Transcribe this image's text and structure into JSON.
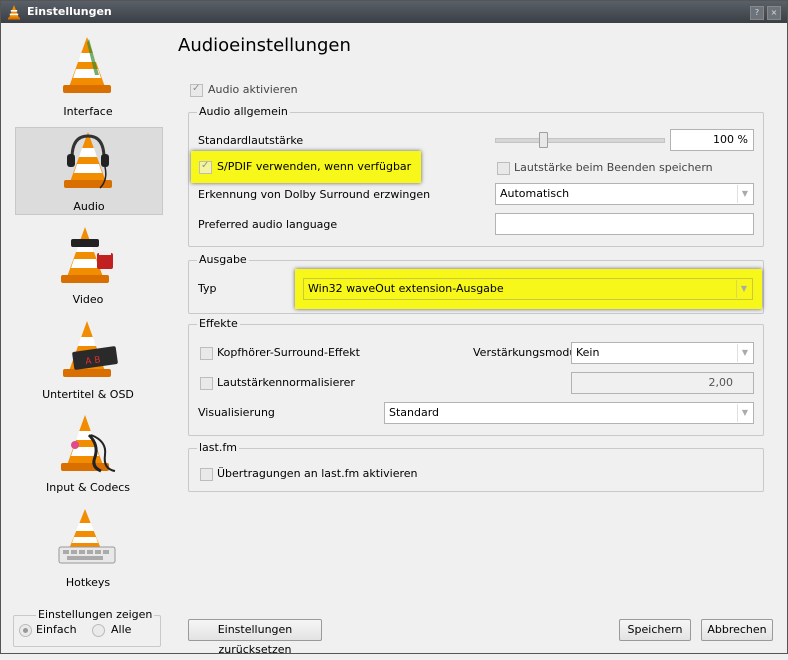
{
  "window": {
    "title": "Einstellungen",
    "buttons": [
      "?",
      "×"
    ]
  },
  "sidebar": {
    "items": [
      {
        "label": "Interface",
        "icon": "vlc-cone-icon"
      },
      {
        "label": "Audio",
        "icon": "vlc-cone-headphones-icon",
        "selected": true
      },
      {
        "label": "Video",
        "icon": "vlc-cone-film-icon"
      },
      {
        "label": "Untertitel & OSD",
        "icon": "vlc-cone-subtitle-icon"
      },
      {
        "label": "Input & Codecs",
        "icon": "vlc-cone-cable-icon"
      },
      {
        "label": "Hotkeys",
        "icon": "vlc-cone-keyboard-icon"
      }
    ],
    "show_settings": {
      "title": "Einstellungen zeigen",
      "simple": "Einfach",
      "all": "Alle",
      "selected": "Einfach"
    }
  },
  "main": {
    "title": "Audioeinstellungen",
    "enable_audio": "Audio aktivieren",
    "general": {
      "title": "Audio allgemein",
      "default_volume_label": "Standardlautstärke",
      "volume_value": "100 %",
      "volume_level_percent": 100,
      "spdif": "S/PDIF verwenden, wenn verfügbar",
      "save_volume": "Lautstärke beim Beenden speichern",
      "dolby_label": "Erkennung von Dolby Surround erzwingen",
      "dolby_value": "Automatisch",
      "lang_label": "Preferred audio language",
      "lang_value": ""
    },
    "output": {
      "title": "Ausgabe",
      "type_label": "Typ",
      "type_value": "Win32 waveOut extension-Ausgabe"
    },
    "effects": {
      "title": "Effekte",
      "headphone": "Kopfhörer-Surround-Effekt",
      "gain_label": "Verstärkungsmodus",
      "gain_value": "Kein",
      "normalizer": "Lautstärkennormalisierer",
      "normalizer_value": "2,00",
      "vis_label": "Visualisierung",
      "vis_value": "Standard"
    },
    "lastfm": {
      "title": "last.fm",
      "submit": "Übertragungen an last.fm aktivieren"
    }
  },
  "footer": {
    "reset": "Einstellungen zurücksetzen",
    "save": "Speichern",
    "cancel": "Abbrechen"
  },
  "colors": {
    "highlight": "#f7f71a",
    "titlebar": "#3a3f45",
    "cone_orange": "#f28c00"
  }
}
